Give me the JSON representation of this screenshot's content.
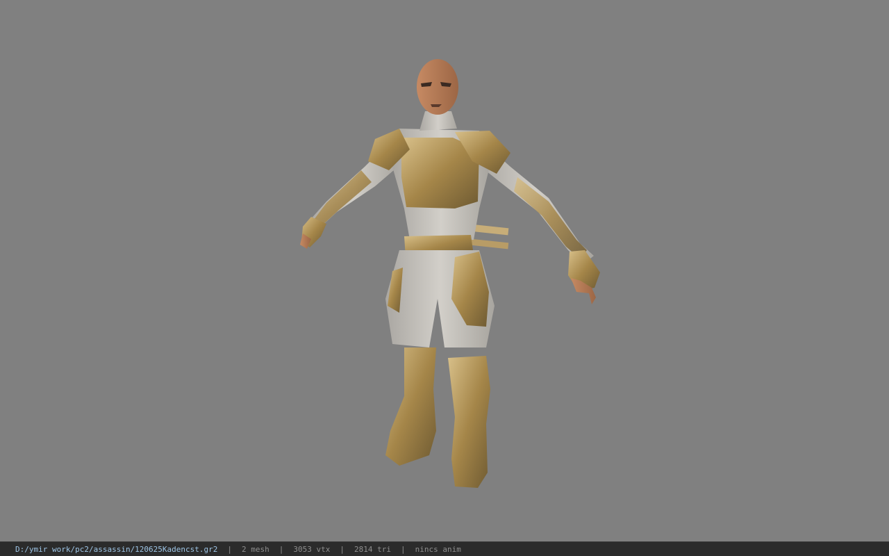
{
  "viewport": {
    "background": "#808080",
    "model_icon": "character-model-icon"
  },
  "status": {
    "file_path": "D:/ymir work/pc2/assassin/120625Kadencst.gr2",
    "separator": "|",
    "mesh": "2 mesh",
    "vertices": "3053 vtx",
    "triangles": "2814 tri",
    "animation": "nincs anim"
  },
  "colors": {
    "path": "#9ec5e6",
    "status_text": "#8e8e8e",
    "status_background": "#2b2b2b",
    "armor_gold": "#b79a5c",
    "cloth": "#c9c6c0",
    "skin": "#b57a55"
  }
}
